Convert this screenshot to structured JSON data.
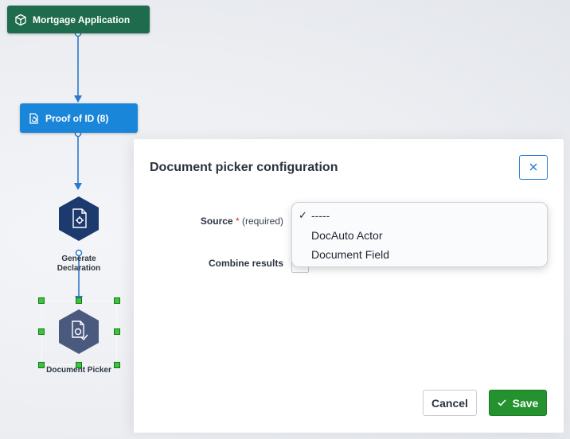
{
  "canvas": {
    "nodes": {
      "mortgage": {
        "label": "Mortgage Application",
        "color": "#1f6b4e"
      },
      "proof": {
        "label": "Proof of ID (8)",
        "color": "#1a86d9"
      },
      "generate": {
        "label_line1": "Generate",
        "label_line2": "Declaration",
        "color": "#1d3a6e"
      },
      "picker": {
        "label": "Document Picker",
        "color": "#4a5a7e"
      }
    },
    "wire_color": "#2b7ac9",
    "selection_color": "#37c837"
  },
  "dialog": {
    "title": "Document picker configuration",
    "close_glyph": "×",
    "source": {
      "label": "Source",
      "required_star": "*",
      "required_text": "(required)",
      "options": [
        {
          "label": "-----",
          "selected": true
        },
        {
          "label": "DocAuto Actor",
          "selected": false
        },
        {
          "label": "Document Field",
          "selected": false
        }
      ],
      "check_glyph": "✓"
    },
    "combine": {
      "label": "Combine results",
      "checked": false
    },
    "buttons": {
      "cancel": "Cancel",
      "save": "Save"
    }
  }
}
